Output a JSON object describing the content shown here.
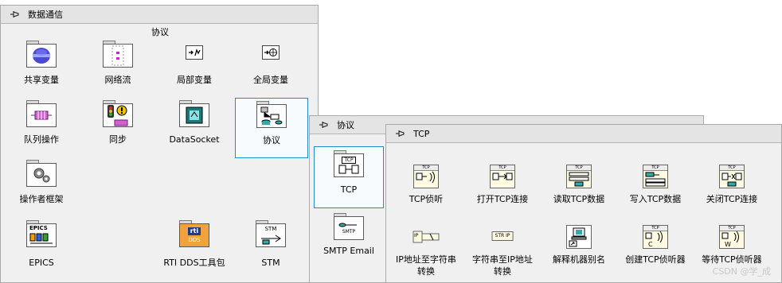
{
  "palettes": {
    "data_comm": {
      "title": "数据通信",
      "subtitle": "协议",
      "items": [
        {
          "label": "共享变量"
        },
        {
          "label": "网络流"
        },
        {
          "label": "局部变量"
        },
        {
          "label": "全局变量"
        },
        {
          "label": "队列操作"
        },
        {
          "label": "同步"
        },
        {
          "label": "DataSocket"
        },
        {
          "label": "协议"
        },
        {
          "label": "操作者框架"
        },
        {
          "label": "EPICS"
        },
        {
          "label": "RTI DDS工具包"
        },
        {
          "label": "STM"
        }
      ]
    },
    "protocol": {
      "title": "协议",
      "items": [
        {
          "label": "TCP"
        },
        {
          "label": "SMTP Email"
        }
      ]
    },
    "tcp": {
      "title": "TCP",
      "items": [
        {
          "label": "TCP侦听"
        },
        {
          "label": "打开TCP连接"
        },
        {
          "label": "读取TCP数据"
        },
        {
          "label": "写入TCP数据"
        },
        {
          "label": "关闭TCP连接"
        },
        {
          "label": "IP地址至字符串\n转换"
        },
        {
          "label": "字符串至IP地址\n转换"
        },
        {
          "label": "解释机器别名"
        },
        {
          "label": "创建TCP侦听器"
        },
        {
          "label": "等待TCP侦听器"
        }
      ]
    }
  },
  "icon_text": {
    "tcp": "TCP",
    "smtp": "SMTP",
    "epics": "EPICS",
    "rti": "rti",
    "dds": "DDS",
    "stm": "STM",
    "ip_str": "IP",
    "str_ip": "STR IP"
  },
  "watermark": "CSDN @学_成",
  "colors": {
    "selection": "#1f8bc9",
    "titlebar": "#e4e4e4",
    "palette_bg": "#f0f0f0"
  }
}
